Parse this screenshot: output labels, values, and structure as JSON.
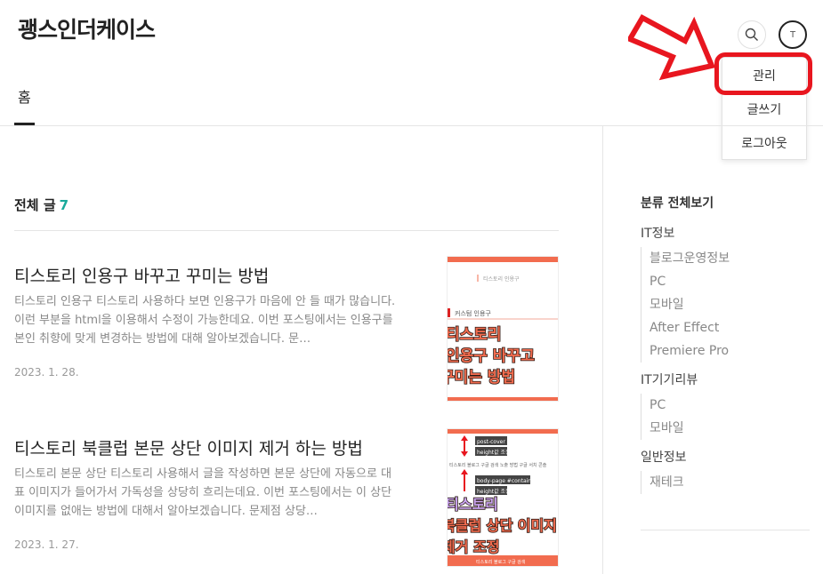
{
  "header": {
    "blog_title": "괭스인더케이스",
    "avatar_initial": "T"
  },
  "user_menu": {
    "items": [
      "관리",
      "글쓰기",
      "로그아웃"
    ]
  },
  "nav": {
    "home_label": "홈"
  },
  "post_list": {
    "heading": "전체 글",
    "count": "7",
    "posts": [
      {
        "title": "티스토리 인용구 바꾸고 꾸미는 방법",
        "excerpt": "티스토리 인용구 티스토리 사용하다 보면 인용구가 마음에 안 들 때가 많습니다. 이런 부분을 html을 이용해서 수정이 가능한데요. 이번 포스팅에서는 인용구를 본인 취향에 맞게 변경하는 방법에 대해 알아보겠습니다. 문…",
        "date": "2023. 1. 28.",
        "thumb": {
          "top_caption": "티스토리 인용구",
          "tag": "커스텀 인용구",
          "lines": [
            "티스토리",
            "인용구 바꾸고",
            "꾸미는 방법"
          ]
        }
      },
      {
        "title": "티스토리 북클럽 본문 상단 이미지 제거 하는 방법",
        "excerpt": "티스토리 본문 상단 티스토리 사용해서 글을 작성하면 본문 상단에 자동으로 대표 이미지가 들어가서 가독성을 상당히 흐리는데요. 이번 포스팅에서는 이 상단 이미지를 없애는 방법에 대해서 알아보겠습니다. 문제점 상당…",
        "date": "2023. 1. 27.",
        "thumb": {
          "label1": "post-cover",
          "label2": "height값 조절",
          "small_text": "티스토리 블로그 구글 검색 노출 방법 구글 서치 콘솔",
          "label3": "body-page #container",
          "label4": "height값 조절",
          "lines": [
            "티스토리",
            "북클럽 상단 이미지",
            "제거 조정"
          ],
          "bottom_caption": "티스토리 블로그 구글 검색"
        }
      }
    ]
  },
  "sidebar": {
    "all_label": "분류 전체보기",
    "groups": [
      {
        "name": "IT정보",
        "items": [
          "블로그운영정보",
          "PC",
          "모바일",
          "After Effect",
          "Premiere Pro"
        ]
      },
      {
        "name": "IT기기리뷰",
        "items": [
          "PC",
          "모바일"
        ]
      },
      {
        "name": "일반정보",
        "items": [
          "재테크"
        ]
      }
    ]
  },
  "colors": {
    "accent": "#1aaa9b",
    "highlight": "#e8161f",
    "thumb_orange": "#f26c4f"
  }
}
